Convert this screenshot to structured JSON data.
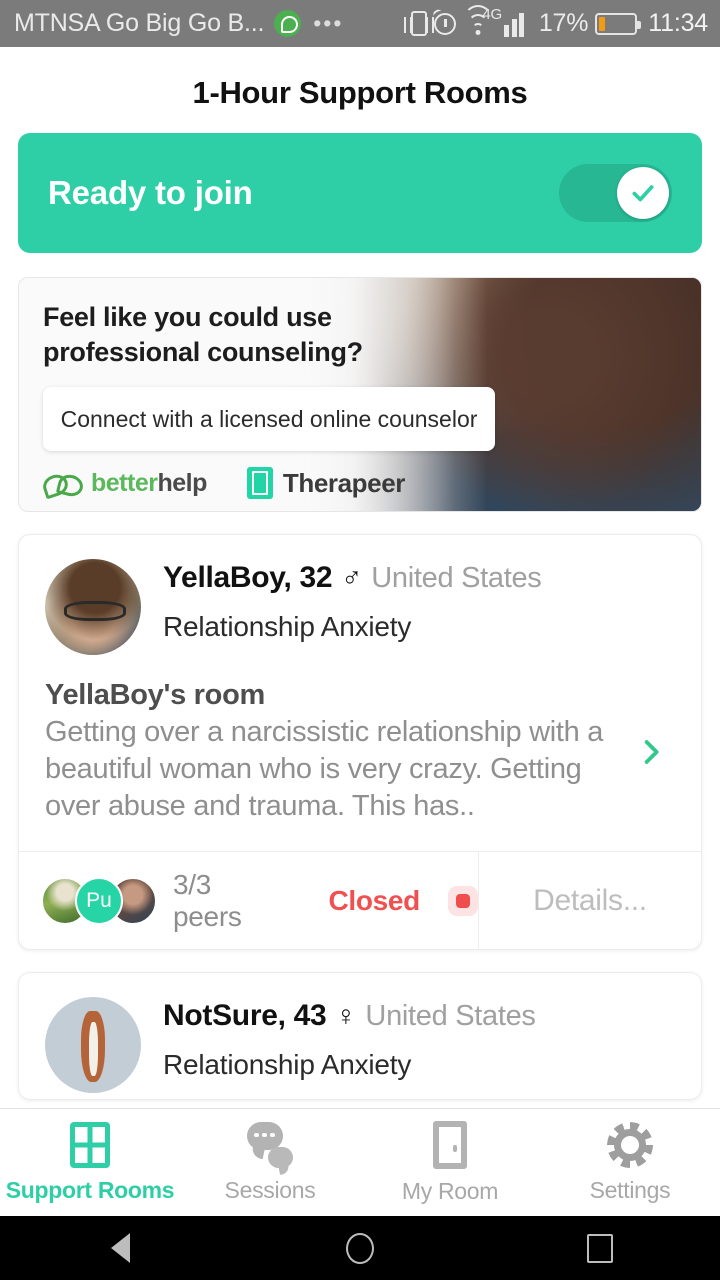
{
  "status_bar": {
    "carrier": "MTNSA Go Big Go B...",
    "whatsapp_icon": "whatsapp-icon",
    "overflow_icon": "•••",
    "vibrate_icon": "vibrate-icon",
    "alarm_icon": "alarm-icon",
    "wifi_icon": "wifi-icon",
    "network_type": "4G",
    "battery_percent": "17%",
    "time": "11:34"
  },
  "header": {
    "title": "1-Hour Support Rooms"
  },
  "ready_banner": {
    "label": "Ready to join",
    "toggle_state": "on",
    "toggle_icon": "check-icon",
    "bg_color": "#2ecfa6",
    "track_color": "#27b793"
  },
  "ad": {
    "headline": "Feel like you could use professional counseling?",
    "cta": "Connect with a licensed online counselor",
    "brand_primary_first": "better",
    "brand_primary_second": "help",
    "brand_secondary": "Therapeer",
    "brand_primary_color": "#5bb85b",
    "brand_secondary_color": "#21d5a7"
  },
  "rooms": [
    {
      "username": "YellaBoy, 32",
      "gender_symbol": "♂",
      "country": "United States",
      "topic": "Relationship Anxiety",
      "room_name": "YellaBoy's room",
      "description": "Getting over a narcissistic relationship with a beautiful woman who is very crazy. Getting over abuse and trauma. This has..",
      "peer_initials": "Pu",
      "peer_count": "3/3 peers",
      "status": "Closed",
      "status_color": "#f05050",
      "details": "Details..."
    },
    {
      "username": "NotSure, 43",
      "gender_symbol": "♀",
      "country": "United States",
      "topic": "Relationship Anxiety"
    }
  ],
  "tabbar": {
    "items": [
      {
        "label": "Support Rooms",
        "icon": "grid-icon",
        "active": true
      },
      {
        "label": "Sessions",
        "icon": "chat-bubbles-icon",
        "active": false
      },
      {
        "label": "My Room",
        "icon": "door-icon",
        "active": false
      },
      {
        "label": "Settings",
        "icon": "gear-icon",
        "active": false
      }
    ],
    "active_color": "#2ecfa6",
    "inactive_color": "#a8a8a8"
  },
  "android_nav": {
    "back": "back-triangle-icon",
    "home": "home-circle-icon",
    "recents": "recents-square-icon"
  }
}
